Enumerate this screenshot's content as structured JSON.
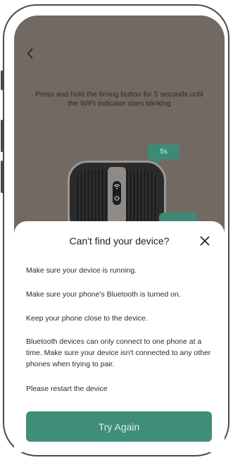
{
  "screen": {
    "back_icon": "‹",
    "instruction": "Press and hold the timing button for 5 seconds until the WIFI indicator stars blinking",
    "timer_label": "5s"
  },
  "dialog": {
    "title": "Can't find your device?",
    "tips": [
      "Make sure your device is running.",
      "Make sure your phone's Bluetooth is turned on.",
      "Keep your phone close to the device.",
      "Bluetooth devices can only connect to one phone at a time. Make sure your device isn't connected to any other phones when trying to pair.",
      "Please restart the device"
    ],
    "button_label": "Try Again"
  },
  "colors": {
    "accent": "#3f8e78",
    "background": "#726963"
  },
  "icons": {
    "back": "chevron-left-icon",
    "close": "close-icon",
    "wifi": "wifi-icon",
    "power": "power-icon"
  }
}
